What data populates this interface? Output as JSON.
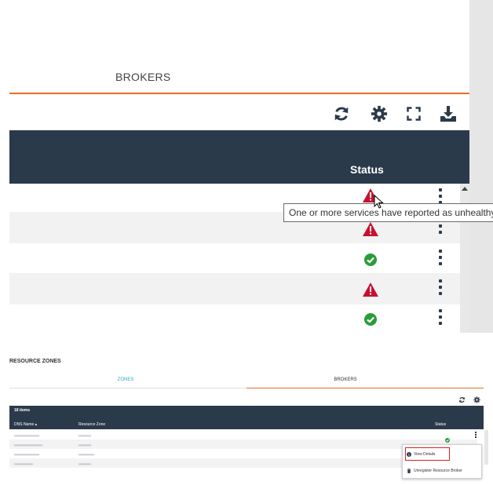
{
  "zoomed_view": {
    "tab_label": "BROKERS",
    "toolbar": {
      "icons": [
        "refresh-icon",
        "gear-icon",
        "fullscreen-icon",
        "download-icon"
      ]
    },
    "table": {
      "status_header": "Status",
      "rows": [
        {
          "status": "warning"
        },
        {
          "status": "warning"
        },
        {
          "status": "ok"
        },
        {
          "status": "warning"
        },
        {
          "status": "ok"
        }
      ]
    },
    "tooltip": "One or more services have reported as unhealthy."
  },
  "resource_zones": {
    "title": "RESOURCE ZONES",
    "tabs": [
      {
        "label": "ZONES",
        "active": false
      },
      {
        "label": "BROKERS",
        "active": true
      }
    ],
    "item_count": "18 items",
    "columns": {
      "dns_name": "DNS Name ▴",
      "resource_zone": "Resource Zone",
      "status": "Status"
    },
    "context_menu": {
      "view_details": "View Details",
      "unregister": "Unregister Resource Broker"
    }
  },
  "colors": {
    "accent_orange": "#f26d21",
    "header_navy": "#2b3a4a",
    "ok_green": "#2a9d3a",
    "warning_red": "#c8102e",
    "tab_blue": "#2ea7c8"
  }
}
